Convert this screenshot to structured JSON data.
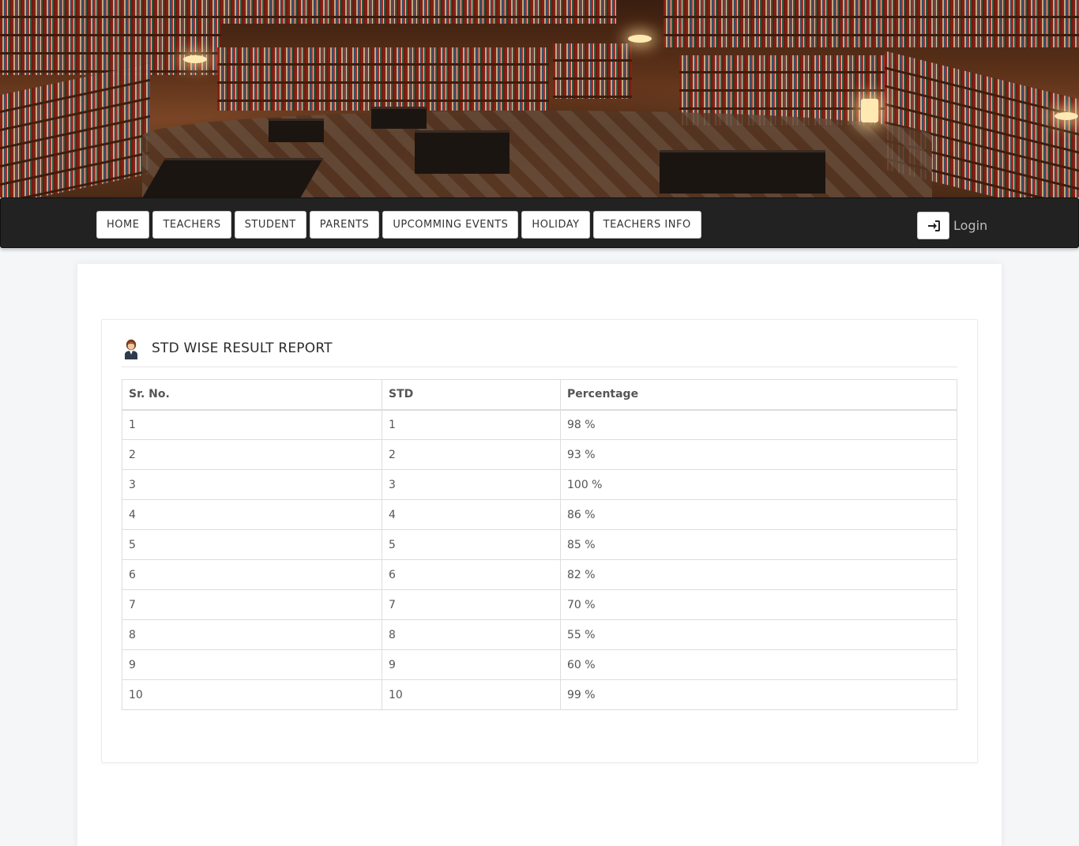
{
  "nav": {
    "items": [
      {
        "label": "HOME",
        "name": "nav-home"
      },
      {
        "label": "TEACHERS",
        "name": "nav-teachers"
      },
      {
        "label": "STUDENT",
        "name": "nav-student"
      },
      {
        "label": "PARENTS",
        "name": "nav-parents"
      },
      {
        "label": "UPCOMMING EVENTS",
        "name": "nav-upcomming-events"
      },
      {
        "label": "HOLIDAY",
        "name": "nav-holiday"
      },
      {
        "label": "TEACHERS INFO",
        "name": "nav-teachers-info"
      }
    ],
    "login_label": "Login",
    "login_icon": "sign-in-icon"
  },
  "report": {
    "title": "STD WISE RESULT REPORT",
    "icon": "teacher-avatar-icon",
    "columns": [
      "Sr. No.",
      "STD",
      "Percentage"
    ],
    "rows": [
      [
        "1",
        "1",
        "98 %"
      ],
      [
        "2",
        "2",
        "93 %"
      ],
      [
        "3",
        "3",
        "100 %"
      ],
      [
        "4",
        "4",
        "86 %"
      ],
      [
        "5",
        "5",
        "85 %"
      ],
      [
        "6",
        "6",
        "82 %"
      ],
      [
        "7",
        "7",
        "70 %"
      ],
      [
        "8",
        "8",
        "55 %"
      ],
      [
        "9",
        "9",
        "60 %"
      ],
      [
        "10",
        "10",
        "99 %"
      ]
    ]
  },
  "colors": {
    "navbar_bg": "#222222",
    "page_bg": "#f5f6f8",
    "table_border": "#dddddd"
  }
}
